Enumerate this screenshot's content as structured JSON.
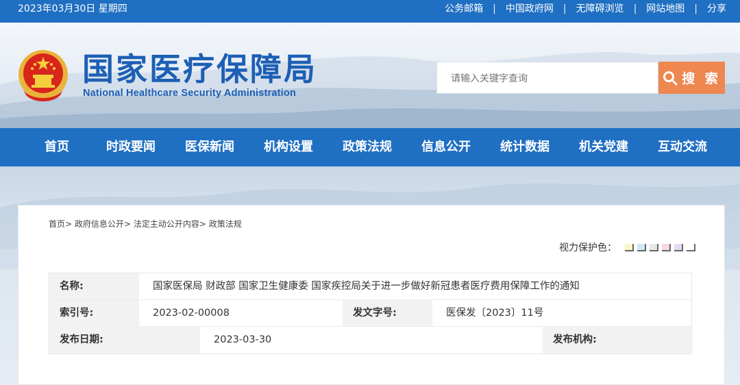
{
  "topbar": {
    "date": "2023年03月30日 星期四",
    "links": [
      "公务邮箱",
      "中国政府网",
      "无障碍浏览",
      "网站地图",
      "分享"
    ],
    "separator": "|"
  },
  "header": {
    "title_cn": "国家医疗保障局",
    "title_en": "National Healthcare Security Administration",
    "emblem_icon": "national-emblem-icon"
  },
  "search": {
    "placeholder": "请输入关键字查询",
    "button_label": "搜 索",
    "button_color": "#ee8750"
  },
  "nav": {
    "items": [
      "首页",
      "时政要闻",
      "医保新闻",
      "机构设置",
      "政策法规",
      "信息公开",
      "统计数据",
      "机关党建",
      "互动交流"
    ],
    "color": "#1f6fc3"
  },
  "breadcrumb": {
    "items": [
      "首页",
      "政府信息公开",
      "法定主动公开内容",
      "政策法规"
    ],
    "separator": ">"
  },
  "vision": {
    "label": "视力保护色：",
    "colors": [
      "#fbf6c8",
      "#cfe9f3",
      "#e8e8e8",
      "#f6d9e1",
      "#e6d9f2",
      "#ffffff"
    ]
  },
  "meta": {
    "name_label": "名称:",
    "name_value": "国家医保局 财政部 国家卫生健康委 国家疾控局关于进一步做好新冠患者医疗费用保障工作的通知",
    "index_label": "索引号:",
    "index_value": "2023-02-00008",
    "docno_label": "发文字号:",
    "docno_value": "医保发〔2023〕11号",
    "date_label": "发布日期:",
    "date_value": "2023-03-30",
    "org_label": "发布机构:",
    "org_value": ""
  }
}
